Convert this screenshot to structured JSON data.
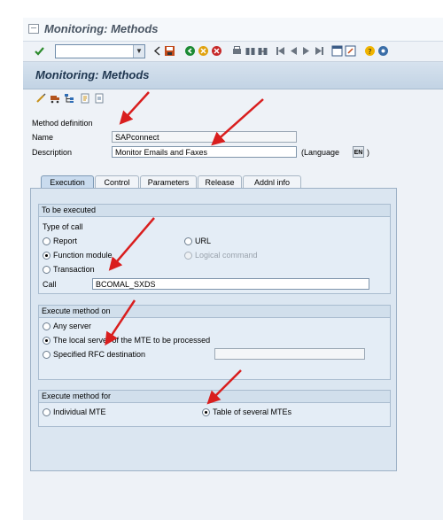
{
  "window": {
    "title": "Monitoring: Methods"
  },
  "app": {
    "title": "Monitoring: Methods"
  },
  "method": {
    "section_label": "Method definition",
    "name_label": "Name",
    "name_value": "SAPconnect",
    "description_label": "Description",
    "description_value": "Monitor Emails and Faxes",
    "language_label": "(Language",
    "language_value": "EN",
    "language_close": ")"
  },
  "tabs": [
    "Execution",
    "Control",
    "Parameters",
    "Release",
    "Addnl info"
  ],
  "to_be_executed": {
    "header": "To be executed",
    "type_of_call_label": "Type of call",
    "report": "Report",
    "function_module": "Function module",
    "transaction": "Transaction",
    "url": "URL",
    "logical_command": "Logical command",
    "call_label": "Call",
    "call_value": "BCOMAL_SXDS"
  },
  "execute_on": {
    "header": "Execute method on",
    "any_server": "Any server",
    "local_server": "The local server of the MTE to be processed",
    "rfc_destination": "Specified RFC destination"
  },
  "execute_for": {
    "header": "Execute method for",
    "individual": "Individual MTE",
    "table": "Table of several MTEs"
  },
  "colors": {
    "annotation_arrow": "#d91e1e",
    "title_bar": "#c2d3e4"
  }
}
